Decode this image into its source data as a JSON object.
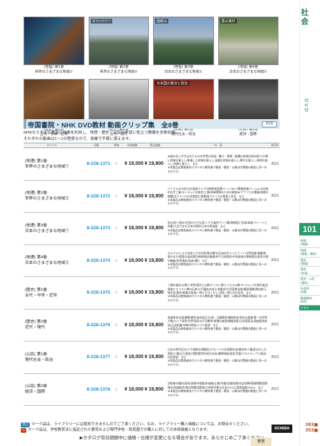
{
  "thumbnails": [
    {
      "caption": "(地理) 第1巻\n世界のさまざまな地域①",
      "tag": ""
    },
    {
      "caption": "(地理) 第2巻\n世界のさまざまな地域②",
      "tag": "マイ•ツリー"
    },
    {
      "caption": "(地理) 第3巻\n日本のさまざまな地域①",
      "tag": "函館山"
    },
    {
      "caption": "(地理) 第4巻\n日本のさまざまな地域②",
      "tag": "農山漁村"
    },
    {
      "caption": "(歴史) 第1巻\n古代・中世・近世",
      "tag": ""
    },
    {
      "caption": "(歴史) 第2巻\n近代・現代",
      "tag": ""
    },
    {
      "caption": "(公民) 第1巻\n現代社会・政治",
      "tag": "日本国の憲法と政治"
    },
    {
      "caption": "(公民) 第2巻\n経済・国際",
      "tag": ""
    }
  ],
  "banner": {
    "title": "帝国書院・NHK DVD教材 動画クリップ集　全8巻",
    "badge": "DVD"
  },
  "intro": "NHKならではの豊富な映像を利用し、地理・歴史・公民の学習に役立つ教養を多数収録。\nそれぞれの動画は1〜2分程度なので、授業で手軽に使えます。",
  "table_header": [
    "タイトル",
    "品番",
    "単価",
    "本体価格",
    "税込価格",
    "内　容",
    "発売年"
  ],
  "products": [
    {
      "title": "(地理) 第1巻\n世界のさまざまな地域①",
      "code": "8-228-1371",
      "mark": "☆",
      "price": "¥ 18,000",
      "price_tax": "¥ 19,800",
      "desc": "赤道の近くが生まれたものの世界の気候／暑さ・過寒・酷暑の地域の読み取り方/寒い地域の暮らし/乾燥した地域の暮らし/温暖な地域の暮らし/寒冷な暮らし/高地の暮らし/宗教と暮らし　など\n※本製品は教育者向けデジタル教科書で動画・解説・公開ほか関連の動画と同一のものです。",
      "year": "2021"
    },
    {
      "title": "(地理) 第2巻\n世界のさまざまな地域②",
      "code": "8-228-1372",
      "mark": "☆",
      "price": "¥ 18,000",
      "price_tax": "¥ 19,800",
      "desc": "ベトナムの水処方法/東南アジアの熱帯林変遷/インドのICT関連産業/フィルムの伝統的な手工業/ヨーロッパの統合/工業/地球環境のための取組み/アフリカの農業/地理の課題/北アメリカの合衆国と産業/南アメリカの貿易と変化　など\n※本製品は教育者向けデジタル教科書で動画・解説・公開ほか関連の動画と同一のものです。",
      "year": "2021"
    },
    {
      "title": "(地理) 第3巻\n日本のさまざまな地域①",
      "code": "8-228-1373",
      "mark": "☆",
      "price": "¥ 18,000",
      "price_tax": "¥ 19,800",
      "desc": "防災地/三角州/天然の小さな湾/リアス海岸/サンゴ礁/果樹園と気候/津波/プレートと地震/さまざまな日本の地形/日本の雨温図　など\n※本製品は教育者向けデジタル教科書で動画・解説・公開ほか関連の動画と同一のものです。",
      "year": "2021"
    },
    {
      "title": "(地理) 第4巻\n日本のさまざまな地域②",
      "code": "8-228-1374",
      "mark": "☆",
      "price": "¥ 18,000",
      "price_tax": "¥ 19,800",
      "desc": "カルデラ/シラス台地とその利用/竜の朝市/石油化学コンビナート/世界遺産/閉鎖湖/鉄のまち/野菜の促成栽培/新幹線の開通/原子力発電所/中央高地の果樹栽培/東京の都市機能/世界遺産/清流/港町　など\n※本製品は教育者向けデジタル教科書で動画・解説・公開ほか関連の動画と同一のものです。",
      "year": "2021"
    },
    {
      "title": "(歴史) 第1巻\n古代・中世・近世",
      "code": "8-228-1375",
      "mark": "☆",
      "price": "¥ 18,000",
      "price_tax": "¥ 19,800",
      "desc": "人類の進化/仏教と寺院/漢字と仏教/キリスト教とイスラム教/ヨーロッパの海外進出/鉄砲とキリスト教の伝来/江戸幕府の成立/参勤交代/武家諸法度/鎖国/朝鮮通信使/元禄文化/蘭学/産業の発達/一揆と打ちこわし/百姓一揆と村の自治　など\n※本製品は教育者向けデジタル教科書で動画・解説・公開ほか関連の動画と同一のものです。",
      "year": "2021"
    },
    {
      "title": "(歴史) 第2巻\n近代・現代",
      "code": "8-228-1376",
      "mark": "☆",
      "price": "¥ 18,000",
      "price_tax": "¥ 19,800",
      "desc": "産業革命/民族運動/戦争/条約改正/日清・日露戦争/韓国併合/明治の産業/第一次世界大戦/ロシア革命/世界恐慌/太平洋戦争/原爆の被害/戦後改革/日本国憲法/高度経済成長/石油危機/冷戦の終結/バブル経済　など\n※本製品は教育者向けデジタル教科書で動画・解説・公開ほか関連の動画と同一のものです。",
      "year": "2021"
    },
    {
      "title": "(公民) 第1巻\n現代社会・政治",
      "code": "8-228-1377",
      "mark": "☆",
      "price": "¥ 18,000",
      "price_tax": "¥ 19,800",
      "desc": "日本の時代区分/少子高齢化/情報化/グローバル化/国際社会/基本的人権/憲法の三大原則/三権分立/国会/内閣/裁判所/地方自治/選挙制度/政党/世論/マスメディアと政治/住民参加　など\n※本製品は教育者向けデジタル教科書で動画・解説・公開ほか関連の動画と同一のものです。",
      "year": "2021"
    },
    {
      "title": "(公民) 第2巻\n経済・国際",
      "code": "8-228-1378",
      "mark": "☆",
      "price": "¥ 18,000",
      "price_tax": "¥ 19,800",
      "desc": "消費者の権利/契約/流通/市場経済/価格/企業/労働/金融/財政/社会保障/環境問題/国際連合/地域統合/南北問題/国際協力/持続可能な社会/ODAと国際貢献/SDGs　など\n※本製品は教育者向けデジタル教科書で動画・解説・公開ほか関連の動画と同一のものです。",
      "year": "2021"
    }
  ],
  "footnotes": [
    {
      "badge": "禁止",
      "badge_color": "#2a7ab8",
      "text": "マーク品は、ライブラリーには使用できませんのでご了承ください。なお、ライブラリー購入価格については、お問合せください。"
    },
    {
      "badge": "☆",
      "badge_color": "#c04a22",
      "text": "マーク品は、学校教育法に指定された教育および専門学校・保育園での購入に対しての本体価格となります。"
    }
  ],
  "maker": "UCHIDA",
  "warning": "▶カタログ有効期間中に価格・仕様が変更になる場合があります。あらかじめご了承ください。",
  "sidebar": {
    "category": "社会",
    "section": "DVD",
    "page": "101",
    "items": [
      "地理\n(地図)",
      "地理\n(掛図・資料)",
      "歴史\n(掛図)",
      "歴史\n(年表)",
      "歴史・公民\n(資料)",
      "社会科\n共通",
      "動画教材\nDVD",
      "ソフト"
    ],
    "active_index": 7,
    "bottom_pages": "383■\n353■"
  },
  "bottom_tab": "教室"
}
